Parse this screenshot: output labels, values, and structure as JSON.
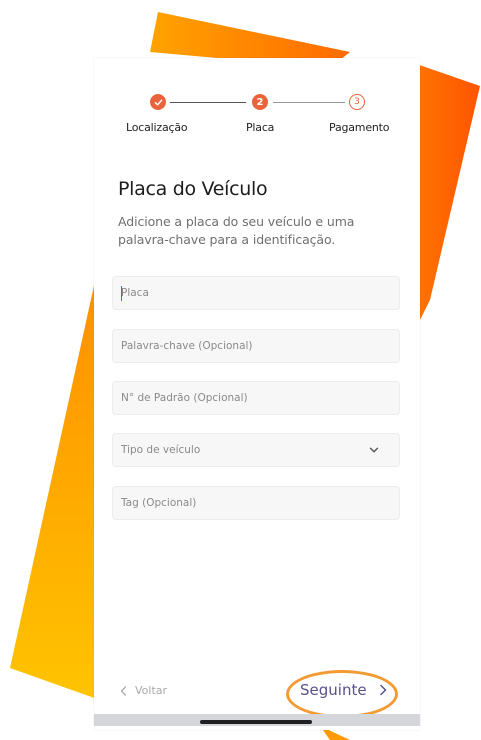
{
  "colors": {
    "accent": "#e9643a",
    "decoration_orange": "#f26a13",
    "decoration_yellow": "#ffb800",
    "highlight_ring": "#f39a33",
    "next_text": "#5b4f8c"
  },
  "stepper": {
    "steps": [
      {
        "label": "Localização",
        "state": "done",
        "icon": "check-icon"
      },
      {
        "label": "Placa",
        "state": "active",
        "number": "2"
      },
      {
        "label": "Pagamento",
        "state": "pending",
        "number": "3"
      }
    ]
  },
  "header": {
    "title": "Placa do Veículo",
    "subtitle": "Adicione a placa do seu veículo e uma palavra-chave para a identificação."
  },
  "form": {
    "placa": {
      "placeholder": "Placa",
      "value": ""
    },
    "palavra_chave": {
      "placeholder": "Palavra-chave (Opcional)",
      "value": ""
    },
    "padrao": {
      "placeholder": "N° de Padrão (Opcional)",
      "value": ""
    },
    "tipo_veiculo": {
      "placeholder": "Tipo de veículo",
      "icon": "chevron-down-icon"
    },
    "tag": {
      "placeholder": "Tag (Opcional)",
      "value": ""
    }
  },
  "footer": {
    "back_label": "Voltar",
    "next_label": "Seguinte"
  }
}
